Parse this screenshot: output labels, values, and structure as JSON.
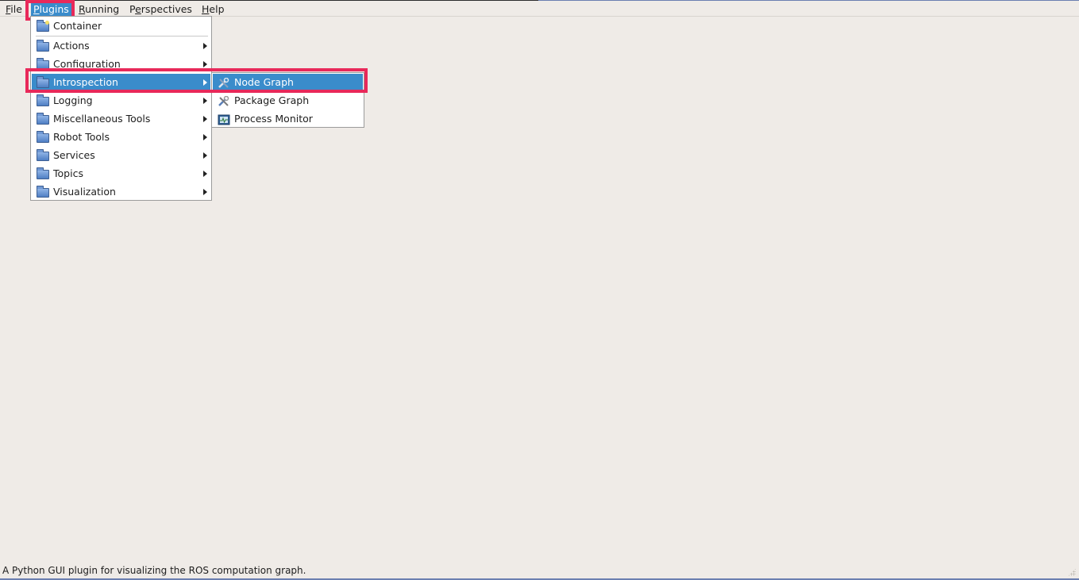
{
  "menubar": {
    "items": [
      {
        "label": "File",
        "mnemonic": "F"
      },
      {
        "label": "Plugins",
        "mnemonic": "P",
        "active": true
      },
      {
        "label": "Running",
        "mnemonic": "R"
      },
      {
        "label": "Perspectives",
        "mnemonic": "e"
      },
      {
        "label": "Help",
        "mnemonic": "H"
      }
    ]
  },
  "plugins_menu": {
    "items": [
      {
        "label": "Container",
        "icon": "folder-new-icon",
        "submenu": false
      },
      {
        "label": "Actions",
        "icon": "folder-icon",
        "submenu": true
      },
      {
        "label": "Configuration",
        "icon": "folder-icon",
        "submenu": true
      },
      {
        "label": "Introspection",
        "icon": "folder-icon",
        "submenu": true,
        "selected": true
      },
      {
        "label": "Logging",
        "icon": "folder-icon",
        "submenu": true
      },
      {
        "label": "Miscellaneous Tools",
        "icon": "folder-icon",
        "submenu": true
      },
      {
        "label": "Robot Tools",
        "icon": "folder-icon",
        "submenu": true
      },
      {
        "label": "Services",
        "icon": "folder-icon",
        "submenu": true
      },
      {
        "label": "Topics",
        "icon": "folder-icon",
        "submenu": true
      },
      {
        "label": "Visualization",
        "icon": "folder-icon",
        "submenu": true
      }
    ]
  },
  "introspection_submenu": {
    "items": [
      {
        "label": "Node Graph",
        "icon": "tools-icon",
        "selected": true
      },
      {
        "label": "Package Graph",
        "icon": "tools-icon"
      },
      {
        "label": "Process Monitor",
        "icon": "monitor-icon"
      }
    ]
  },
  "statusbar": {
    "text": "A Python GUI plugin for visualizing the ROS computation graph."
  },
  "colors": {
    "highlight": "#e8295a",
    "selection": "#3a8ccb",
    "background": "#efebe7"
  }
}
